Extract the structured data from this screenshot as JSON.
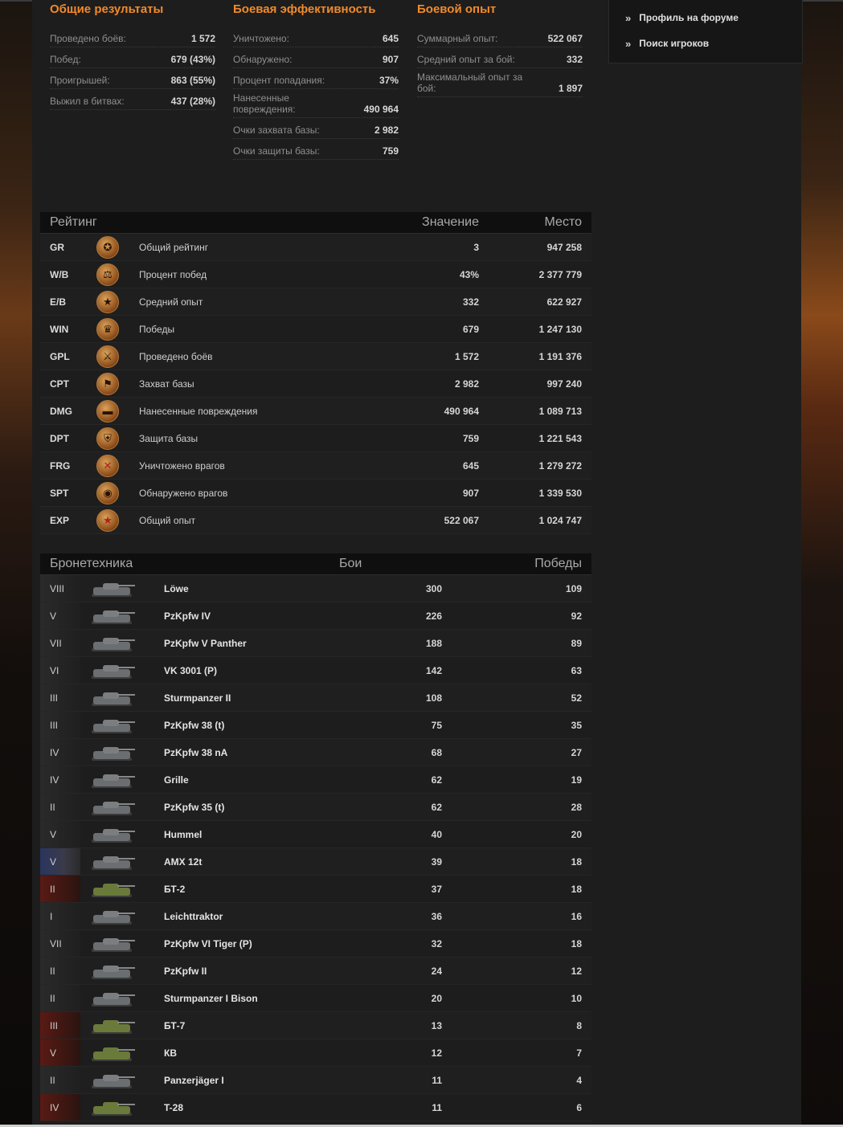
{
  "overall": {
    "title": "Общие результаты",
    "rows": [
      {
        "label": "Проведено боёв:",
        "value": "1 572"
      },
      {
        "label": "Побед:",
        "value": "679 (43%)"
      },
      {
        "label": "Проигрышей:",
        "value": "863 (55%)"
      },
      {
        "label": "Выжил в битвах:",
        "value": "437 (28%)"
      }
    ]
  },
  "combat": {
    "title": "Боевая эффективность",
    "rows": [
      {
        "label": "Уничтожено:",
        "value": "645"
      },
      {
        "label": "Обнаружено:",
        "value": "907"
      },
      {
        "label": "Процент попадания:",
        "value": "37%"
      },
      {
        "label": "Нанесенные повреждения:",
        "value": "490 964"
      },
      {
        "label": "Очки захвата базы:",
        "value": "2 982"
      },
      {
        "label": "Очки защиты базы:",
        "value": "759"
      }
    ]
  },
  "experience": {
    "title": "Боевой опыт",
    "rows": [
      {
        "label": "Суммарный опыт:",
        "value": "522 067"
      },
      {
        "label": "Средний опыт за бой:",
        "value": "332"
      },
      {
        "label": "Максимальный опыт за бой:",
        "value": "1 897"
      }
    ]
  },
  "sidebar": {
    "links": [
      {
        "label": "Профиль на форуме"
      },
      {
        "label": "Поиск игроков"
      }
    ]
  },
  "rating": {
    "headers": {
      "name": "Рейтинг",
      "value": "Значение",
      "place": "Место"
    },
    "rows": [
      {
        "code": "GR",
        "icon": "general-rating-medal-icon",
        "name": "Общий рейтинг",
        "value": "3",
        "place": "947 258"
      },
      {
        "code": "W/B",
        "icon": "scales-medal-icon",
        "name": "Процент побед",
        "value": "43%",
        "place": "2 377 779"
      },
      {
        "code": "E/B",
        "icon": "star-medal-icon",
        "name": "Средний опыт",
        "value": "332",
        "place": "622 927"
      },
      {
        "code": "WIN",
        "icon": "cup-medal-icon",
        "name": "Победы",
        "value": "679",
        "place": "1 247 130"
      },
      {
        "code": "GPL",
        "icon": "crossed-swords-medal-icon",
        "name": "Проведено боёв",
        "value": "1 572",
        "place": "1 191 376"
      },
      {
        "code": "CPT",
        "icon": "flag-medal-icon",
        "name": "Захват базы",
        "value": "2 982",
        "place": "997 240"
      },
      {
        "code": "DMG",
        "icon": "tank-medal-icon",
        "name": "Нанесенные повреждения",
        "value": "490 964",
        "place": "1 089 713"
      },
      {
        "code": "DPT",
        "icon": "shield-medal-icon",
        "name": "Защита базы",
        "value": "759",
        "place": "1 221 543"
      },
      {
        "code": "FRG",
        "icon": "crossed-tank-medal-icon",
        "name": "Уничтожено врагов",
        "value": "645",
        "place": "1 279 272"
      },
      {
        "code": "SPT",
        "icon": "binoculars-medal-icon",
        "name": "Обнаружено врагов",
        "value": "907",
        "place": "1 339 530"
      },
      {
        "code": "EXP",
        "icon": "red-star-medal-icon",
        "name": "Общий опыт",
        "value": "522 067",
        "place": "1 024 747"
      }
    ]
  },
  "vehicles": {
    "headers": {
      "name": "Бронетехника",
      "battles": "Бои",
      "wins": "Победы"
    },
    "rows": [
      {
        "tier": "VIII",
        "name": "Löwe",
        "battles": "300",
        "wins": "109",
        "nation": "de"
      },
      {
        "tier": "V",
        "name": "PzKpfw IV",
        "battles": "226",
        "wins": "92",
        "nation": "de"
      },
      {
        "tier": "VII",
        "name": "PzKpfw V Panther",
        "battles": "188",
        "wins": "89",
        "nation": "de"
      },
      {
        "tier": "VI",
        "name": "VK 3001 (P)",
        "battles": "142",
        "wins": "63",
        "nation": "de"
      },
      {
        "tier": "III",
        "name": "Sturmpanzer II",
        "battles": "108",
        "wins": "52",
        "nation": "de"
      },
      {
        "tier": "III",
        "name": "PzKpfw 38 (t)",
        "battles": "75",
        "wins": "35",
        "nation": "de"
      },
      {
        "tier": "IV",
        "name": "PzKpfw 38 nA",
        "battles": "68",
        "wins": "27",
        "nation": "de"
      },
      {
        "tier": "IV",
        "name": "Grille",
        "battles": "62",
        "wins": "19",
        "nation": "de"
      },
      {
        "tier": "II",
        "name": "PzKpfw 35 (t)",
        "battles": "62",
        "wins": "28",
        "nation": "de"
      },
      {
        "tier": "V",
        "name": "Hummel",
        "battles": "40",
        "wins": "20",
        "nation": "de"
      },
      {
        "tier": "V",
        "name": "AMX 12t",
        "battles": "39",
        "wins": "18",
        "nation": "fr"
      },
      {
        "tier": "II",
        "name": "БТ-2",
        "battles": "37",
        "wins": "18",
        "nation": "ussr"
      },
      {
        "tier": "I",
        "name": "Leichttraktor",
        "battles": "36",
        "wins": "16",
        "nation": "de"
      },
      {
        "tier": "VII",
        "name": "PzKpfw VI Tiger (P)",
        "battles": "32",
        "wins": "18",
        "nation": "de"
      },
      {
        "tier": "II",
        "name": "PzKpfw II",
        "battles": "24",
        "wins": "12",
        "nation": "de"
      },
      {
        "tier": "II",
        "name": "Sturmpanzer I Bison",
        "battles": "20",
        "wins": "10",
        "nation": "de"
      },
      {
        "tier": "III",
        "name": "БТ-7",
        "battles": "13",
        "wins": "8",
        "nation": "ussr"
      },
      {
        "tier": "V",
        "name": "КВ",
        "battles": "12",
        "wins": "7",
        "nation": "ussr"
      },
      {
        "tier": "II",
        "name": "Panzerjäger I",
        "battles": "11",
        "wins": "4",
        "nation": "de"
      },
      {
        "tier": "IV",
        "name": "T-28",
        "battles": "11",
        "wins": "6",
        "nation": "ussr"
      }
    ]
  }
}
